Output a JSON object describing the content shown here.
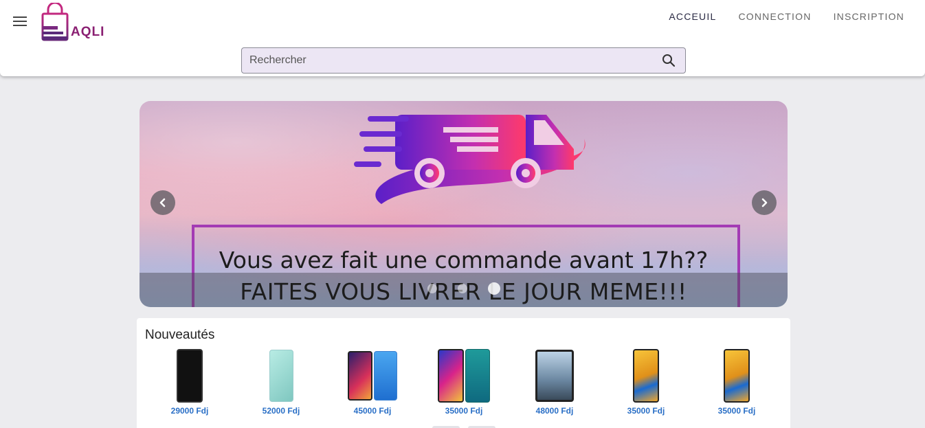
{
  "header": {
    "brand": "AQLI",
    "menu_icon": "menu-icon",
    "nav": [
      {
        "label": "ACCEUIL",
        "active": true
      },
      {
        "label": "CONNECTION",
        "active": false
      },
      {
        "label": "INSCRIPTION",
        "active": false
      }
    ],
    "search": {
      "placeholder": "Rechercher",
      "icon": "search-icon"
    }
  },
  "carousel": {
    "line1": "Vous avez fait une commande avant 17h??",
    "line2": "FAITES VOUS LIVRER LE JOUR MEME!!!",
    "slide_count": 3,
    "active_slide": 3,
    "prev_icon": "chevron-left-icon",
    "next_icon": "chevron-right-icon"
  },
  "products_section": {
    "title": "Nouveautés",
    "items": [
      {
        "price": "29000 Fdj",
        "colors": [
          "#111111"
        ]
      },
      {
        "price": "52000 Fdj",
        "colors": [
          "#8fd3cc"
        ]
      },
      {
        "price": "45000 Fdj",
        "colors": [
          "#1b2a6b",
          "#2a86e0"
        ]
      },
      {
        "price": "35000 Fdj",
        "colors": [
          "#d8238a",
          "#1a8a8a"
        ]
      },
      {
        "price": "48000 Fdj",
        "colors": [
          "#222222"
        ]
      },
      {
        "price": "35000 Fdj",
        "colors": [
          "#f0a62a"
        ]
      },
      {
        "price": "35000 Fdj",
        "colors": [
          "#f0a62a"
        ]
      }
    ]
  },
  "colors": {
    "brand": "#8a1f72",
    "price": "#2a6fc6",
    "search_bg": "#ece6f4"
  }
}
